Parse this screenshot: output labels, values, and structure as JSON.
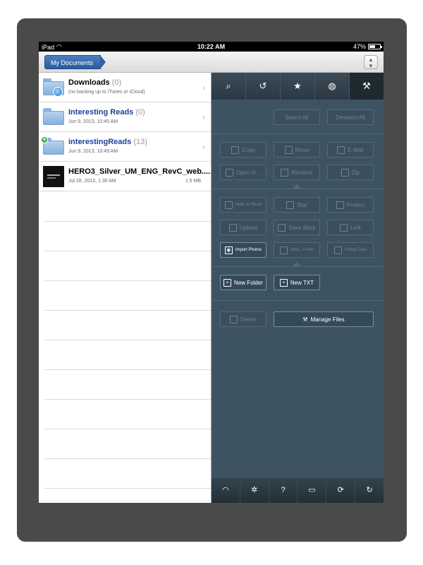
{
  "status": {
    "carrier": "iPad",
    "time": "10:22 AM",
    "battery": "47%",
    "battery_level": 0.47
  },
  "navbar": {
    "back_label": "My Documents",
    "sort_symbol": "⌃⌄"
  },
  "files": [
    {
      "name": "Downloads",
      "count": "(0)",
      "sub": "(no backing up to iTunes or iCloud)"
    },
    {
      "name": "Interesting Reads",
      "count": "(0)",
      "sub": "Jun 9, 2013, 10:45 AM"
    },
    {
      "name": "interestingReads",
      "count": "(13)",
      "sub": "Jun 9, 2013, 10:49 AM"
    },
    {
      "name": "HERO3_Silver_UM_ENG_RevC_web....",
      "sub": "Jul 28, 2013, 1:30 AM",
      "size": "1.5 MB"
    }
  ],
  "panel": {
    "select_all": "Select All",
    "deselect_all": "Deselect All",
    "copy": "Copy",
    "move": "Move",
    "email": "E-Mail",
    "open_in": "Open In...",
    "rename": "Rename",
    "zip": "Zip",
    "mark_as_read": "Mark as Read",
    "star": "Star",
    "protect": "Protect",
    "upload": "Upload",
    "save_back": "Save Back",
    "link": "Link",
    "import_photos": "Import Photos",
    "new_from_paste": "New... Paste",
    "follow_paste": "Follow Data",
    "new_folder": "New Folder",
    "new_txt": "New TXT",
    "delete": "Delete",
    "manage_files": "Manage Files"
  }
}
